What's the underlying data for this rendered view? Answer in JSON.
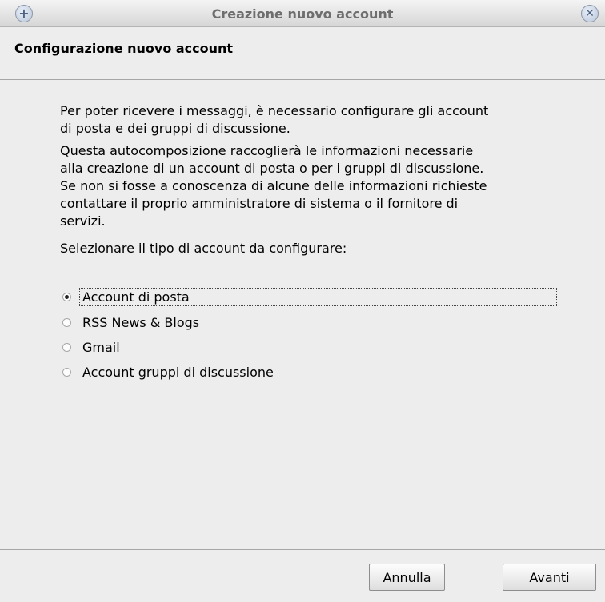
{
  "window": {
    "title": "Creazione nuovo account",
    "menu_icon": "plus-icon",
    "close_icon": "close-icon"
  },
  "header": {
    "heading": "Configurazione nuovo account"
  },
  "main": {
    "paragraph1": "Per poter ricevere i messaggi, è necessario configurare gli account\ndi posta e dei gruppi di discussione.",
    "paragraph2": "Questa autocomposizione raccoglierà le informazioni necessarie\nalla creazione di un account di posta o per i gruppi di discussione.\nSe non si fosse a conoscenza di alcune delle informazioni richieste\ncontattare il proprio amministratore di sistema o il fornitore di\nservizi.",
    "prompt": "Selezionare il tipo di account da configurare:",
    "options": [
      {
        "label": "Account di posta",
        "selected": true
      },
      {
        "label": "RSS News & Blogs",
        "selected": false
      },
      {
        "label": "Gmail",
        "selected": false
      },
      {
        "label": "Account gruppi di discussione",
        "selected": false
      }
    ]
  },
  "footer": {
    "cancel_label": "Annulla",
    "next_label": "Avanti"
  }
}
